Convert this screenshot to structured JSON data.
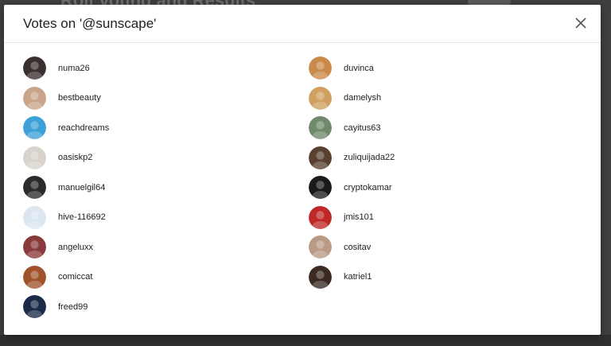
{
  "backdrop": {
    "title": "Roll Voting and Results"
  },
  "modal": {
    "title": "Votes on '@sunscape'",
    "close_icon": "close-icon"
  },
  "voters": [
    {
      "username": "numa26",
      "avatar_color": "#3a3030"
    },
    {
      "username": "duvinca",
      "avatar_color": "#c98a4a"
    },
    {
      "username": "bestbeauty",
      "avatar_color": "#c9a48a"
    },
    {
      "username": "damelysh",
      "avatar_color": "#d0a060"
    },
    {
      "username": "reachdreams",
      "avatar_color": "#3ea0d8"
    },
    {
      "username": "cayitus63",
      "avatar_color": "#6f8a6a"
    },
    {
      "username": "oasiskp2",
      "avatar_color": "#d8d2cc"
    },
    {
      "username": "zuliquijada22",
      "avatar_color": "#5a4030"
    },
    {
      "username": "manuelgil64",
      "avatar_color": "#2a2a2a"
    },
    {
      "username": "cryptokamar",
      "avatar_color": "#1a1a1a"
    },
    {
      "username": "hive-116692",
      "avatar_color": "#dbe6f0"
    },
    {
      "username": "jmis101",
      "avatar_color": "#c02828"
    },
    {
      "username": "angeluxx",
      "avatar_color": "#8a3a3a"
    },
    {
      "username": "cositav",
      "avatar_color": "#b89a86"
    },
    {
      "username": "comiccat",
      "avatar_color": "#a0522d"
    },
    {
      "username": "katriel1",
      "avatar_color": "#3a2a22"
    },
    {
      "username": "freed99",
      "avatar_color": "#1c2a4a"
    }
  ]
}
